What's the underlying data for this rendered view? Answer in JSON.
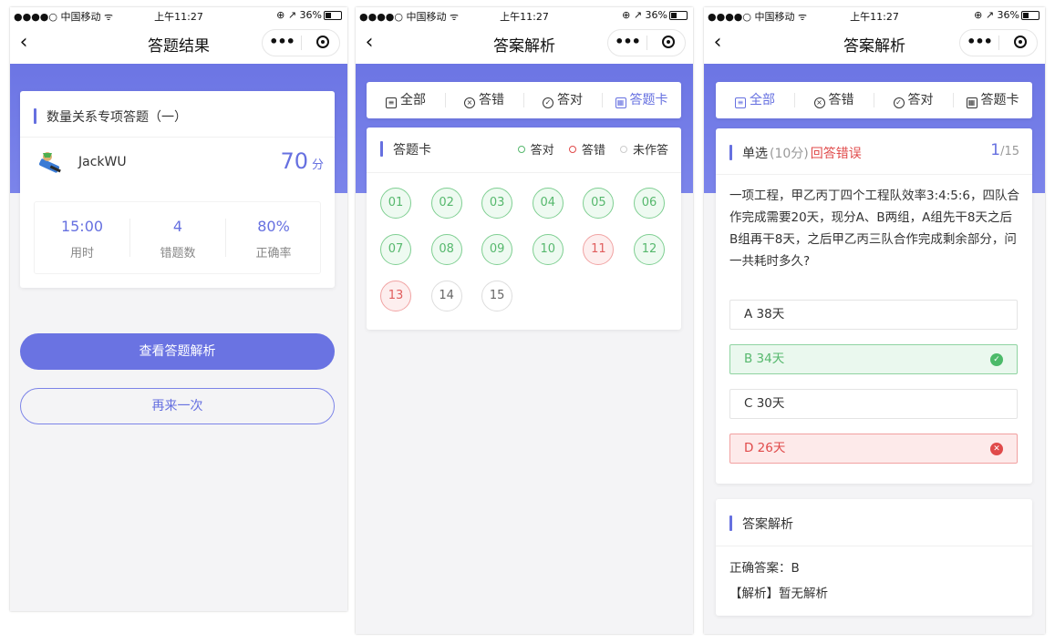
{
  "statusbar": {
    "carrier": "●●●●○ 中国移动 ᯤ",
    "time": "上午11:27",
    "right": "⊕ ↗ 36%"
  },
  "screen1": {
    "title": "答题结果",
    "quiz_name": "数量关系专项答题（一）",
    "user": "JackWU",
    "score": "70",
    "score_unit": "分",
    "stats": [
      {
        "value": "15:00",
        "label": "用时"
      },
      {
        "value": "4",
        "label": "错题数"
      },
      {
        "value": "80%",
        "label": "正确率"
      }
    ],
    "primary_button": "查看答题解析",
    "secondary_button": "再来一次"
  },
  "tabs": [
    "全部",
    "答错",
    "答对",
    "答题卡"
  ],
  "screen2": {
    "title": "答案解析",
    "active_tab": "答题卡",
    "card_title": "答题卡",
    "legend": [
      "答对",
      "答错",
      "未作答"
    ],
    "questions": [
      {
        "n": "01",
        "state": "correct"
      },
      {
        "n": "02",
        "state": "correct"
      },
      {
        "n": "03",
        "state": "correct"
      },
      {
        "n": "04",
        "state": "correct"
      },
      {
        "n": "05",
        "state": "correct"
      },
      {
        "n": "06",
        "state": "correct"
      },
      {
        "n": "07",
        "state": "correct"
      },
      {
        "n": "08",
        "state": "correct"
      },
      {
        "n": "09",
        "state": "correct"
      },
      {
        "n": "10",
        "state": "correct"
      },
      {
        "n": "11",
        "state": "wrong"
      },
      {
        "n": "12",
        "state": "correct"
      },
      {
        "n": "13",
        "state": "wrong"
      },
      {
        "n": "14",
        "state": "unanswered"
      },
      {
        "n": "15",
        "state": "unanswered"
      }
    ]
  },
  "screen3": {
    "title": "答案解析",
    "active_tab": "全部",
    "q_type": "单选",
    "q_points": "(10分)",
    "q_status": "回答错误",
    "q_current": "1",
    "q_total": "/15",
    "question": "一项工程，甲乙丙丁四个工程队效率3:4:5:6，四队合作完成需要20天，现分A、B两组，A组先干8天之后B组再干8天，之后甲乙丙三队合作完成剩余部分，问一共耗时多久?",
    "options": [
      {
        "text": "A  38天",
        "state": "none"
      },
      {
        "text": "B  34天",
        "state": "correct"
      },
      {
        "text": "C  30天",
        "state": "none"
      },
      {
        "text": "D  26天",
        "state": "wrong"
      }
    ],
    "analysis_title": "答案解析",
    "correct_answer": "正确答案：B",
    "explanation": "【解析】暂无解析"
  },
  "colors": {
    "accent": "#6670e0",
    "correct": "#56b86d",
    "wrong": "#e04a4a"
  }
}
